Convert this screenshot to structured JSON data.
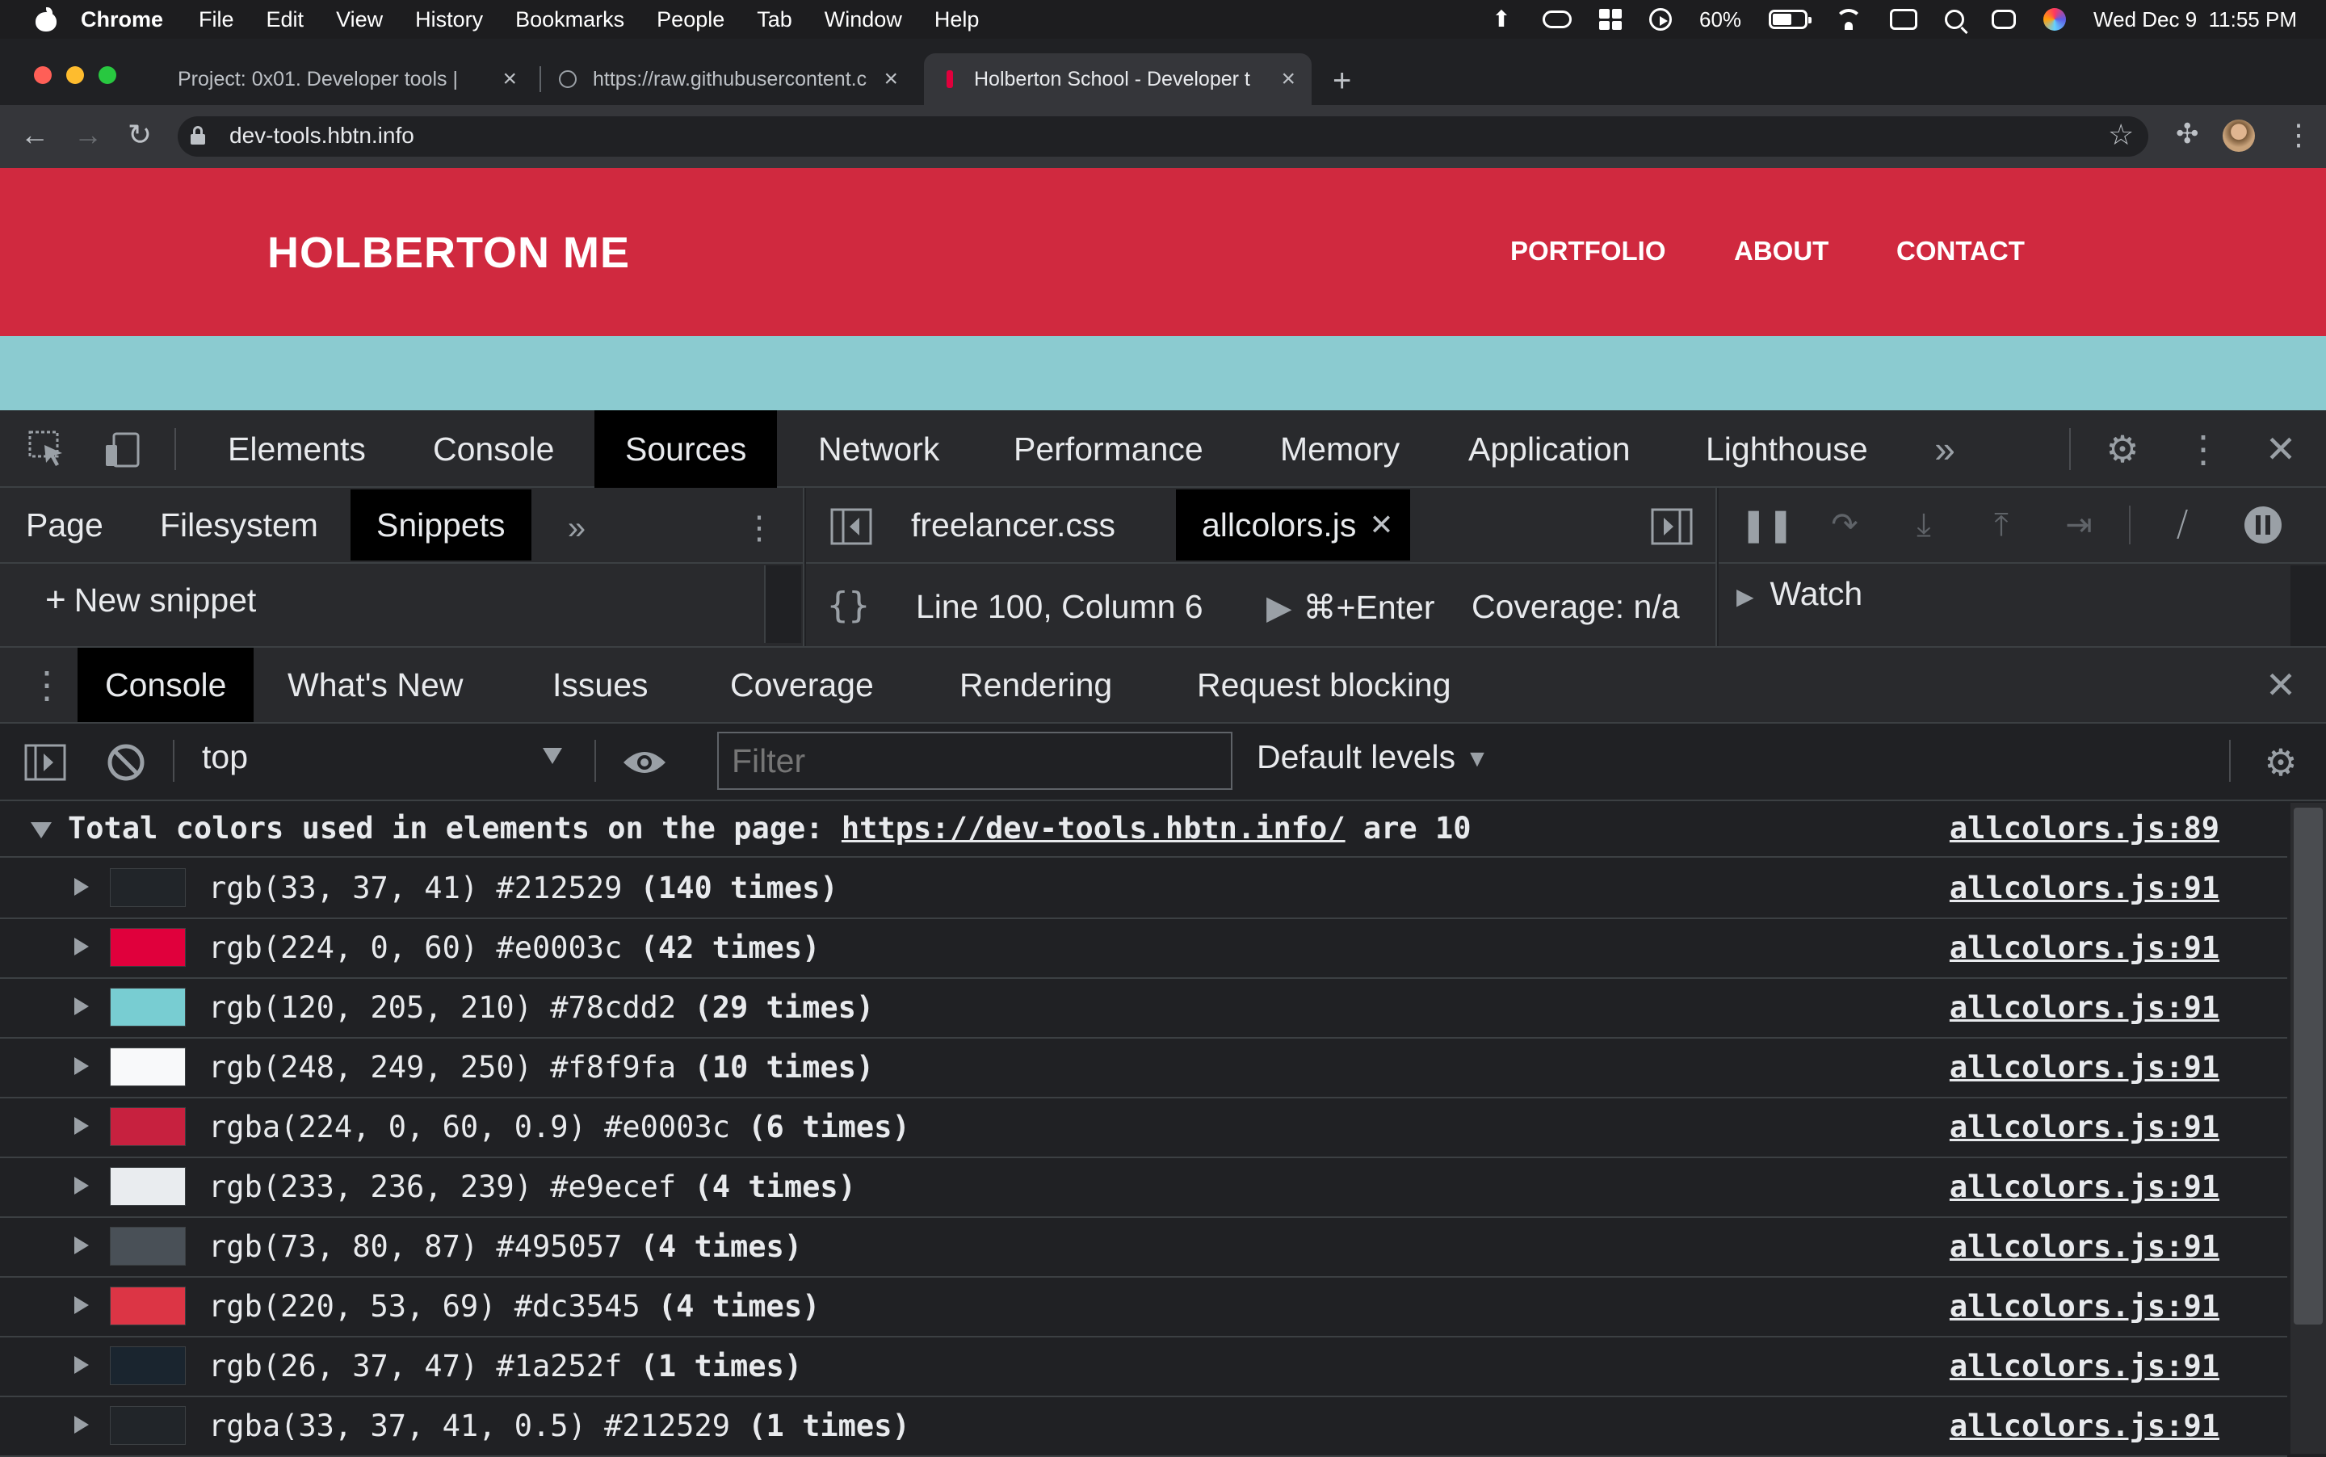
{
  "menubar": {
    "app": "Chrome",
    "items": [
      "File",
      "Edit",
      "View",
      "History",
      "Bookmarks",
      "People",
      "Tab",
      "Window",
      "Help"
    ],
    "battery": "60%",
    "datetime": "Wed Dec 9  11:55 PM"
  },
  "tabs": [
    {
      "title": "Project: 0x01. Developer tools |",
      "active": false
    },
    {
      "title": "https://raw.githubusercontent.c",
      "active": false
    },
    {
      "title": "Holberton School - Developer t",
      "active": true
    }
  ],
  "address": {
    "url": "dev-tools.hbtn.info"
  },
  "site": {
    "logo": "HOLBERTON ME",
    "nav": [
      "PORTFOLIO",
      "ABOUT",
      "CONTACT"
    ],
    "colors": {
      "header": "#d0293f",
      "band": "#8bcbd0"
    }
  },
  "devtools": {
    "main_tabs": [
      "Elements",
      "Console",
      "Sources",
      "Network",
      "Performance",
      "Memory",
      "Application",
      "Lighthouse"
    ],
    "active_main_tab": "Sources",
    "nav_tabs": [
      "Page",
      "Filesystem",
      "Snippets"
    ],
    "active_nav_tab": "Snippets",
    "new_snippet": "New snippet",
    "file_tabs": [
      "freelancer.css",
      "allcolors.js"
    ],
    "active_file": "allcolors.js",
    "status": {
      "position": "Line 100, Column 6",
      "run_shortcut": "⌘+Enter",
      "coverage": "Coverage: n/a"
    },
    "watch_label": "Watch",
    "drawer_tabs": [
      "Console",
      "What's New",
      "Issues",
      "Coverage",
      "Rendering",
      "Request blocking"
    ],
    "active_drawer_tab": "Console",
    "context": "top",
    "filter_placeholder": "Filter",
    "levels": "Default levels"
  },
  "console": {
    "group": {
      "prefix": "Total colors used in elements on the page: ",
      "link": "https://dev-tools.hbtn.info/",
      "suffix": " are 10",
      "source": "allcolors.js:89"
    },
    "rows": [
      {
        "swatch": "#212529",
        "text": "rgb(33, 37, 41) #212529 ",
        "count": "(140 times)",
        "source": "allcolors.js:91"
      },
      {
        "swatch": "#e0003c",
        "text": "rgb(224, 0, 60) #e0003c ",
        "count": "(42 times)",
        "source": "allcolors.js:91"
      },
      {
        "swatch": "#78cdd2",
        "text": "rgb(120, 205, 210) #78cdd2 ",
        "count": "(29 times)",
        "source": "allcolors.js:91"
      },
      {
        "swatch": "#f8f9fa",
        "text": "rgb(248, 249, 250) #f8f9fa ",
        "count": "(10 times)",
        "source": "allcolors.js:91"
      },
      {
        "swatch": "#c7213f",
        "text": "rgba(224, 0, 60, 0.9) #e0003c ",
        "count": "(6 times)",
        "source": "allcolors.js:91"
      },
      {
        "swatch": "#e9ecef",
        "text": "rgb(233, 236, 239) #e9ecef ",
        "count": "(4 times)",
        "source": "allcolors.js:91"
      },
      {
        "swatch": "#495057",
        "text": "rgb(73, 80, 87) #495057 ",
        "count": "(4 times)",
        "source": "allcolors.js:91"
      },
      {
        "swatch": "#dc3545",
        "text": "rgb(220, 53, 69) #dc3545 ",
        "count": "(4 times)",
        "source": "allcolors.js:91"
      },
      {
        "swatch": "#1a252f",
        "text": "rgb(26, 37, 47) #1a252f ",
        "count": "(1 times)",
        "source": "allcolors.js:91"
      },
      {
        "swatch": "#212529",
        "text": "rgba(33, 37, 41, 0.5) #212529 ",
        "count": "(1 times)",
        "source": "allcolors.js:91"
      }
    ]
  }
}
